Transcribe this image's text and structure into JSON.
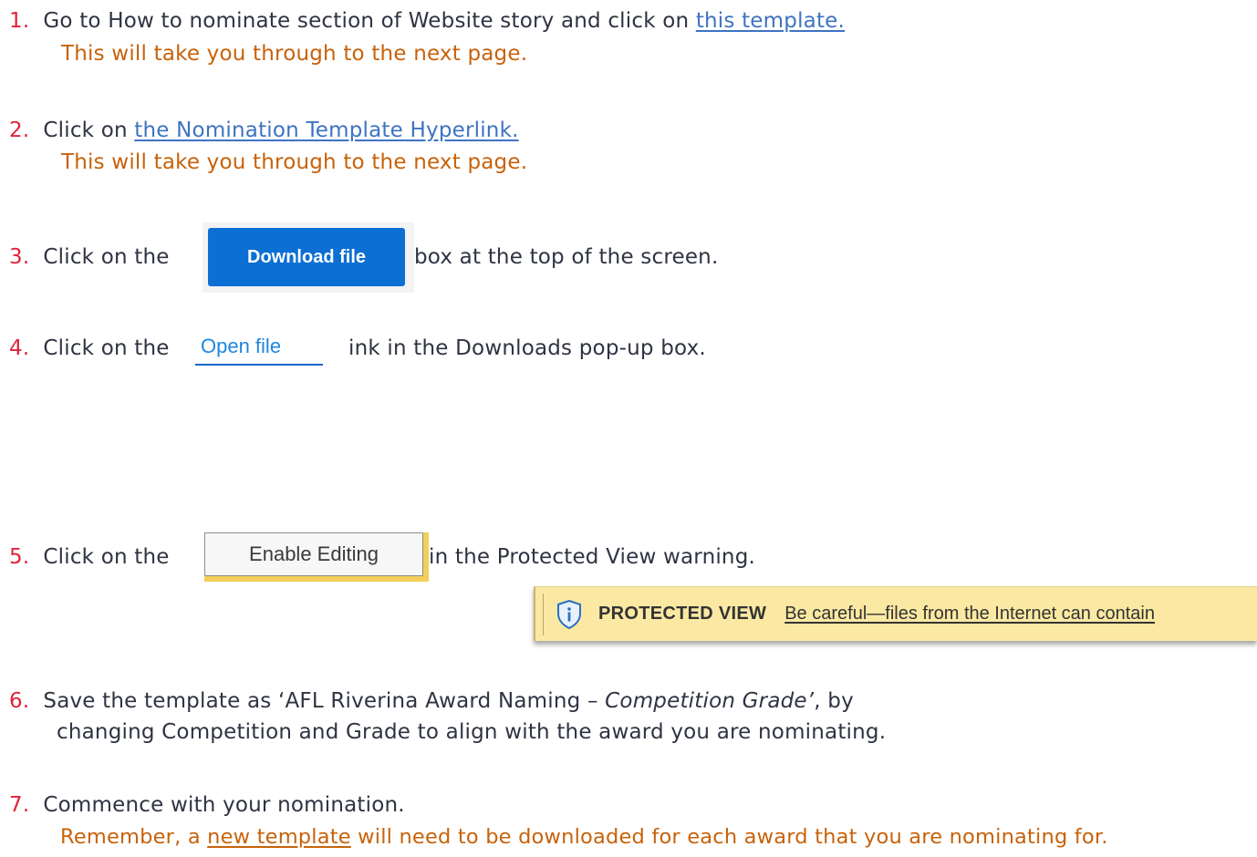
{
  "steps": [
    {
      "number": "1.",
      "text_before": "Go to How to nominate section of Website story and click on ",
      "link": "this template.",
      "note": "This will take you through to the next page."
    },
    {
      "number": "2.",
      "text_before": "Click on ",
      "link": "the Nomination Template Hyperlink.",
      "note": "This will take you through to the next page."
    },
    {
      "number": "3.",
      "text_before": "Click on the",
      "text_after": "box at the top of the screen."
    },
    {
      "number": "4.",
      "text_before": "Click on the",
      "text_after": "ink in the Downloads pop-up box."
    },
    {
      "number": "5.",
      "text_before": "Click on the",
      "text_after": "in the Protected View warning."
    },
    {
      "number": "6.",
      "text_before": "Save the template as ‘AFL Riverina Award Naming – ",
      "italic": "Competition Grade’",
      "text_after": ", by",
      "line2": "changing Competition and Grade to align with the award you are nominating."
    },
    {
      "number": "7.",
      "text": "Commence with your nomination.",
      "note_before": "Remember, a ",
      "note_link": "new template",
      "note_after": " will need to be downloaded for each award that you are nominating for."
    }
  ],
  "download_button": {
    "label": "Download file"
  },
  "open_file_link": {
    "label": "Open file"
  },
  "enable_editing_button": {
    "label": "Enable Editing"
  },
  "protected_view_bar": {
    "title": "PROTECTED VIEW",
    "message": "Be careful—files from the Internet can contain"
  },
  "colors": {
    "number": "#e0243a",
    "note": "#c8620a",
    "link": "#3e73c2",
    "body_text": "#2f3342",
    "download_blue": "#0b6fd4",
    "warning_yellow": "#fbe9a3"
  },
  "icons": [
    "info-shield-icon"
  ]
}
